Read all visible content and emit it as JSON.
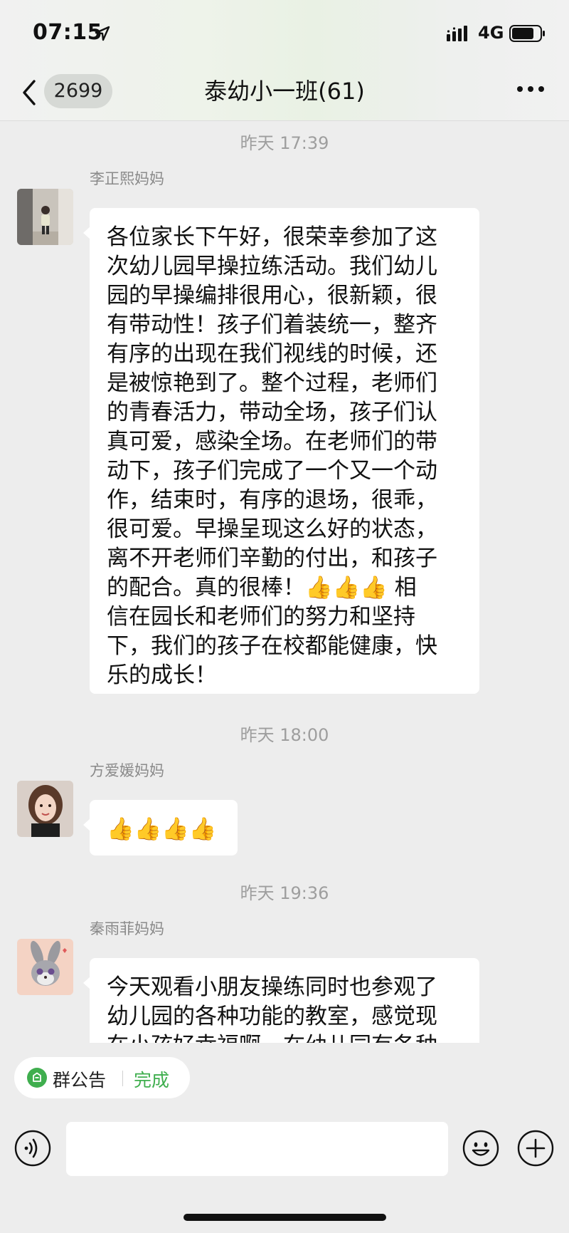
{
  "status_bar": {
    "time": "07:15",
    "network": "4G"
  },
  "nav": {
    "unread_count": "2699",
    "title": "泰幼小一班(61)"
  },
  "messages": [
    {
      "timestamp": "昨天 17:39",
      "sender": "李正熙妈妈",
      "lines": [
        "各位家长下午好，很荣幸参加了这",
        "次幼儿园早操拉练活动。我们幼儿",
        "园的早操编排很用心，很新颖，很",
        "有带动性！孩子们着装统一，整齐",
        "有序的出现在我们视线的时候，还",
        "是被惊艳到了。整个过程，老师们",
        "的青春活力，带动全场，孩子们认",
        "真可爱，感染全场。在老师们的带",
        "动下，孩子们完成了一个又一个动",
        "作，结束时，有序的退场，很乖，",
        "很可爱。早操呈现这么好的状态，",
        "离不开老师们辛勤的付出，和孩子",
        "的配合。真的很棒！👍👍👍 相",
        "信在园长和老师们的努力和坚持",
        "下，我们的孩子在校都能健康，快",
        "乐的成长！"
      ]
    },
    {
      "timestamp": "昨天 18:00",
      "sender": "方爱媛妈妈",
      "lines": [
        "👍👍👍👍"
      ]
    },
    {
      "timestamp": "昨天 19:36",
      "sender": "秦雨菲妈妈",
      "lines": [
        "今天观看小朋友操练同时也参观了",
        "幼儿园的各种功能的教室，感觉现",
        "在小孩好幸福啊，在幼儿园有各种"
      ]
    }
  ],
  "bottom": {
    "notice_label": "群公告",
    "notice_action": "完成",
    "input_value": ""
  },
  "icons": {
    "back": "chevron-left-icon",
    "more": "more-dots-icon",
    "voice": "voice-icon",
    "emoji": "emoji-icon",
    "plus": "plus-icon",
    "notice": "notice-icon"
  },
  "colors": {
    "background": "#ededed",
    "bubble": "#ffffff",
    "accent_green": "#3fae4e",
    "timestamp_gray": "#9e9e9e"
  }
}
